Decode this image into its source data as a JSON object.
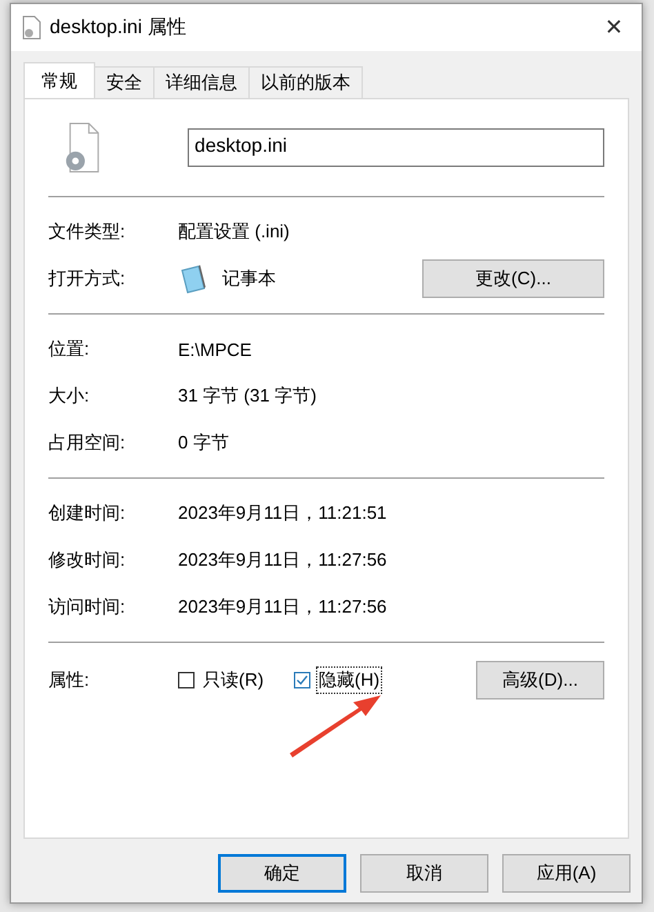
{
  "window": {
    "title": "desktop.ini 属性",
    "close": "✕"
  },
  "tabs": [
    {
      "label": "常规",
      "selected": true
    },
    {
      "label": "安全",
      "selected": false
    },
    {
      "label": "详细信息",
      "selected": false
    },
    {
      "label": "以前的版本",
      "selected": false
    }
  ],
  "file_name": "desktop.ini",
  "sections": [
    [
      {
        "kind": "text",
        "label": "文件类型:",
        "value": "配置设置 (.ini)"
      },
      {
        "kind": "app",
        "label": "打开方式:",
        "value": "记事本",
        "button": "更改(C)..."
      }
    ],
    [
      {
        "kind": "text",
        "label": "位置:",
        "value": "E:\\MPCE"
      },
      {
        "kind": "text",
        "label": "大小:",
        "value": "31 字节 (31 字节)"
      },
      {
        "kind": "text",
        "label": "占用空间:",
        "value": "0 字节"
      }
    ],
    [
      {
        "kind": "text",
        "label": "创建时间:",
        "value": "2023年9月11日，11:21:51"
      },
      {
        "kind": "text",
        "label": "修改时间:",
        "value": "2023年9月11日，11:27:56"
      },
      {
        "kind": "text",
        "label": "访问时间:",
        "value": "2023年9月11日，11:27:56"
      }
    ]
  ],
  "attributes": {
    "label": "属性:",
    "checkboxes": [
      {
        "label": "只读(R)",
        "checked": false,
        "focused": false
      },
      {
        "label": "隐藏(H)",
        "checked": true,
        "focused": true
      }
    ],
    "button": "高级(D)..."
  },
  "buttons": [
    {
      "label": "确定",
      "default": true
    },
    {
      "label": "取消",
      "default": false
    },
    {
      "label": "应用(A)",
      "default": false
    }
  ]
}
